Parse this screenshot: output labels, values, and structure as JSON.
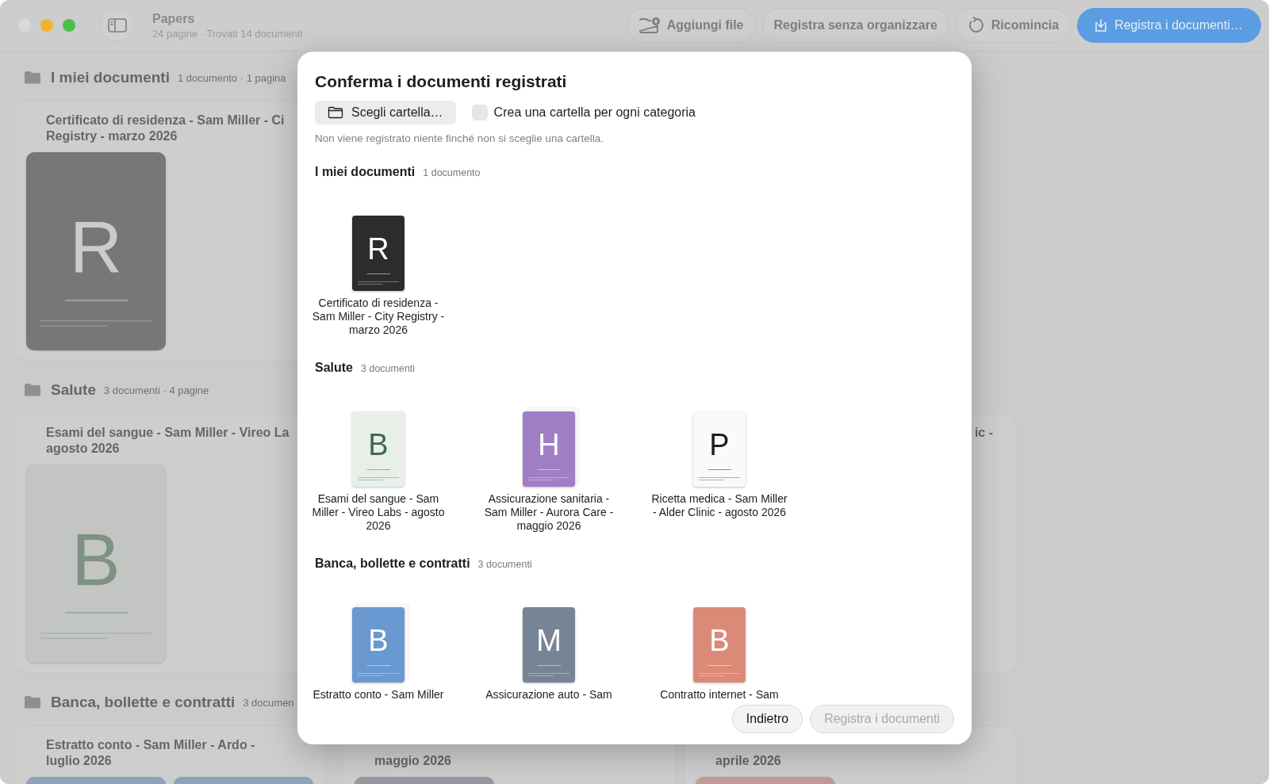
{
  "window": {
    "title": "Papers",
    "subtitle": "24 pagine · Trovati 14 documenti"
  },
  "toolbar": [
    {
      "kind": "add",
      "label": "Aggiungi file"
    },
    {
      "kind": "plain",
      "label": "Registra senza organizzare"
    },
    {
      "kind": "restart",
      "label": "Ricomincia"
    },
    {
      "kind": "primary",
      "label": "Registra i documenti…"
    }
  ],
  "sections": [
    {
      "title": "I miei documenti",
      "meta": "1 documento · 1 pagina",
      "cards": [
        {
          "kind": "full",
          "title": "Certificato di residenza - Sam Miller - Ci\nRegistry - marzo 2026",
          "pages": [
            {
              "letter": {
                "text": "R",
                "color": "#cbcbcb"
              },
              "color": "#777778"
            }
          ]
        }
      ]
    },
    {
      "title": "Salute",
      "meta": "3 documenti · 4 pagine",
      "cards": [
        {
          "kind": "full",
          "title": "Esami del sangue - Sam Miller - Vireo La\nagosto 2026",
          "pages": [
            {
              "letter": {
                "text": "B",
                "color": "#7f9085"
              },
              "color": "#c2c5c2"
            }
          ]
        },
        {
          "kind": "tail",
          "title": "ic -"
        }
      ]
    },
    {
      "title": "Banca, bollette e contratti",
      "meta": "3 documen",
      "cards": [
        {
          "kind": "full",
          "title": "Estratto conto - Sam Miller - Ardo -\nluglio 2026",
          "pages": [
            {
              "color": "#90a2b8"
            },
            {
              "color": "#90a2b8"
            }
          ]
        },
        {
          "kind": "under",
          "title": "maggio 2026",
          "pages": [
            {
              "color": "#959aa1"
            }
          ]
        },
        {
          "kind": "under",
          "title": "aprile 2026",
          "pages": [
            {
              "color": "#bd9d96"
            }
          ]
        }
      ]
    }
  ],
  "dialog": {
    "title": "Conferma i documenti registrati",
    "folder_button": "Scegli cartella…",
    "checkbox": {
      "label": "Crea una cartella per ogni categoria",
      "checked": false
    },
    "hint": "Non viene registrato niente finché non si sceglie una cartella.",
    "groups": [
      {
        "title": "I miei documenti",
        "count": "1 documento",
        "docs": [
          {
            "letter": {
              "text": "R",
              "color": "#ffffff"
            },
            "color": "#2c2c2e",
            "stacked": false,
            "label": "Certificato di residenza - Sam Miller - City Registry - marzo 2026"
          }
        ]
      },
      {
        "title": "Salute",
        "count": "3 documenti",
        "docs": [
          {
            "letter": {
              "text": "B",
              "color": "#3f6a4e"
            },
            "color": "#e8efe9",
            "stacked": false,
            "label": "Esami del sangue - Sam Miller - Vireo Labs - agosto 2026"
          },
          {
            "letter": {
              "text": "H",
              "color": "#ffffff"
            },
            "color": "#a07fc6",
            "stacked": true,
            "label": "Assicurazione sanitaria - Sam Miller - Aurora Care - maggio 2026"
          },
          {
            "letter": {
              "text": "P",
              "color": "#1f1f1f"
            },
            "color": "#fafafa",
            "stacked": false,
            "label": "Ricetta medica - Sam Miller - Alder Clinic - agosto 2026"
          }
        ]
      },
      {
        "title": "Banca, bollette e contratti",
        "count": "3 documenti",
        "docs": [
          {
            "letter": {
              "text": "B",
              "color": "#ffffff"
            },
            "color": "#6a98d0",
            "stacked": true,
            "label": "Estratto conto - Sam Miller"
          },
          {
            "letter": {
              "text": "M",
              "color": "#ffffff"
            },
            "color": "#778495",
            "stacked": false,
            "label": "Assicurazione auto - Sam"
          },
          {
            "letter": {
              "text": "B",
              "color": "#ffffff"
            },
            "color": "#dc8a78",
            "stacked": false,
            "label": "Contratto internet - Sam"
          }
        ]
      }
    ],
    "buttons": [
      {
        "label": "Indietro",
        "disabled": false
      },
      {
        "label": "Registra i documenti",
        "disabled": true
      }
    ]
  }
}
